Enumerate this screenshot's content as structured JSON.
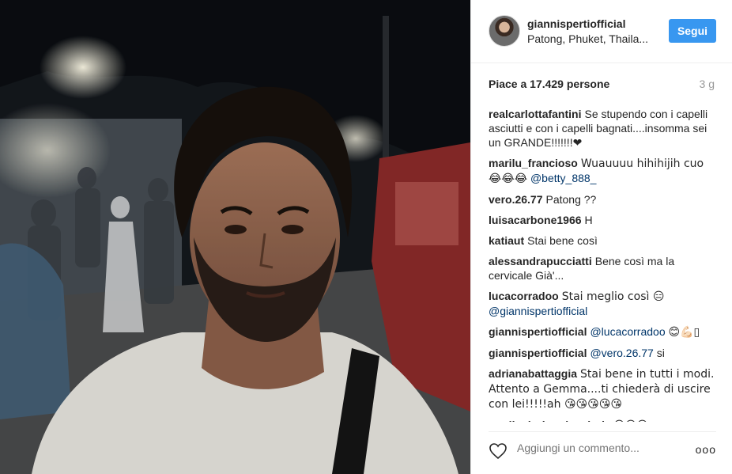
{
  "post": {
    "username": "giannispertiofficial",
    "location": "Patong, Phuket, Thaila...",
    "follow_label": "Segui",
    "likes": "Piace a 17.429 persone",
    "time_ago": "3 g"
  },
  "comments": [
    {
      "user": "realcarlottafantini",
      "text": "Se stupendo con i capelli asciutti e con i capelli bagnati....insomma sei un GRANDE!!!!!!!❤"
    },
    {
      "user": "marilu_francioso",
      "text": "Wuauuuu hihihijih cuo 😂😂😂",
      "mention": "@betty_888_"
    },
    {
      "user": "vero.26.77",
      "text": "Patong ??"
    },
    {
      "user": "luisacarbone1966",
      "text": "H"
    },
    {
      "user": "katiaut",
      "text": "Stai bene così"
    },
    {
      "user": "alessandrapucciatti",
      "text": "Bene così ma la cervicale Già'..."
    },
    {
      "user": "lucacorradoo",
      "text": "Stai meglio così 😑",
      "mention": "@giannispertiofficial"
    },
    {
      "user": "giannispertiofficial",
      "mention": "@lucacorradoo",
      "text": "😊💪🏻▯"
    },
    {
      "user": "giannispertiofficial",
      "mention": "@vero.26.77",
      "text": "si"
    },
    {
      "user": "adrianabattaggia",
      "text": "Stai bene in tutti i modi. Attento a Gemma....ti chiederà di uscire con lei!!!!!ah 😘😘😘😘😘"
    },
    {
      "user": "marikadorigopiccoloriz",
      "text": "😍😍😍"
    }
  ],
  "footer": {
    "add_comment_placeholder": "Aggiungi un commento...",
    "more": "ooo"
  },
  "icons": {
    "like": "heart-outline-icon",
    "options": "more-options-icon"
  },
  "colors": {
    "follow_button": "#3897f0",
    "mention": "#003569",
    "muted": "#999999"
  }
}
